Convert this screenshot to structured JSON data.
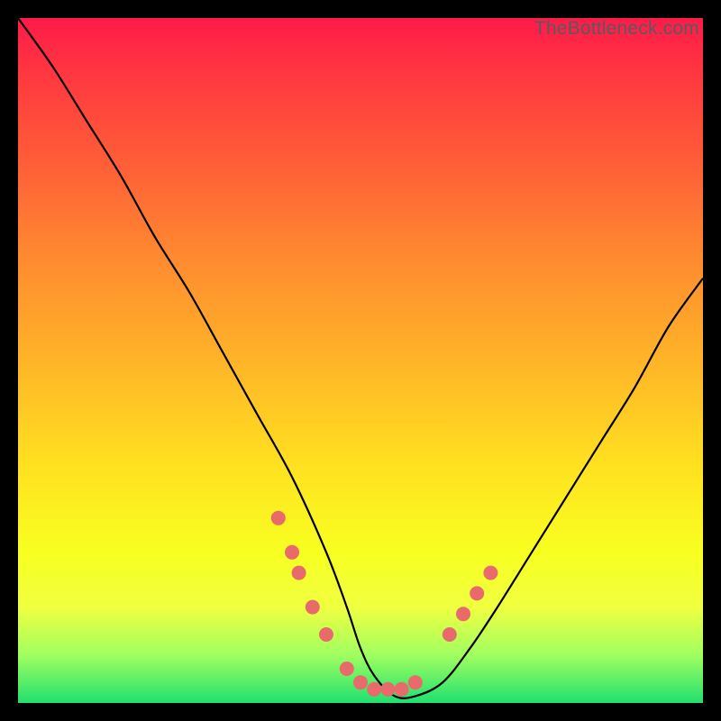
{
  "watermark": "TheBottleneck.com",
  "chart_data": {
    "type": "line",
    "title": "",
    "xlabel": "",
    "ylabel": "",
    "xlim": [
      0,
      100
    ],
    "ylim": [
      0,
      100
    ],
    "series": [
      {
        "name": "bottleneck-curve",
        "x": [
          0,
          5,
          10,
          15,
          20,
          25,
          30,
          35,
          40,
          45,
          48,
          50,
          52,
          55,
          58,
          62,
          66,
          70,
          75,
          80,
          85,
          90,
          95,
          100
        ],
        "y": [
          100,
          93,
          85,
          77,
          68,
          60,
          51,
          42,
          33,
          22,
          14,
          8,
          4,
          1,
          1,
          3,
          8,
          14,
          22,
          30,
          38,
          46,
          55,
          62
        ]
      }
    ],
    "marker_points": {
      "x": [
        38,
        40,
        41,
        43,
        45,
        48,
        50,
        52,
        54,
        56,
        58,
        63,
        65,
        67,
        69
      ],
      "y": [
        27,
        22,
        19,
        14,
        10,
        5,
        3,
        2,
        2,
        2,
        3,
        10,
        13,
        16,
        19
      ]
    },
    "background_gradient": {
      "top": "#ff1a4a",
      "mid": "#ffe020",
      "bottom": "#20e070"
    }
  }
}
